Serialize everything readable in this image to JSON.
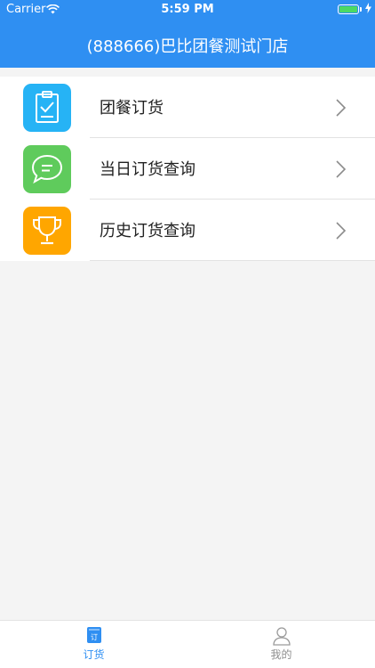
{
  "status_bar": {
    "carrier": "Carrier",
    "time": "5:59 PM"
  },
  "header": {
    "title": "(888666)巴比团餐测试门店"
  },
  "colors": {
    "header": "#2f8ff2",
    "order_icon": "#26b3f5",
    "today_icon": "#5fcb5c",
    "history_icon": "#ffa600",
    "active_tab": "#2f8ff2",
    "inactive_tab": "#8e8e8e"
  },
  "menu": {
    "items": [
      {
        "label": "团餐订货",
        "icon": "clipboard-check-icon"
      },
      {
        "label": "当日订货查询",
        "icon": "chat-bubble-icon"
      },
      {
        "label": "历史订货查询",
        "icon": "trophy-icon"
      }
    ]
  },
  "tabbar": {
    "tabs": [
      {
        "label": "订货",
        "icon_text": "订",
        "active": true
      },
      {
        "label": "我的",
        "active": false
      }
    ]
  }
}
